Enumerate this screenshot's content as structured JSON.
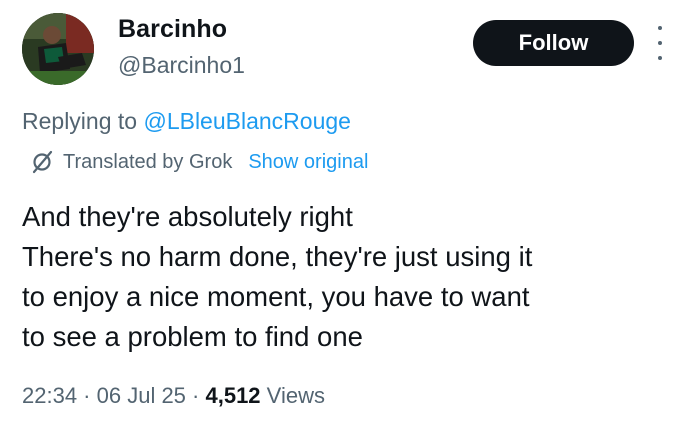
{
  "author": {
    "display_name": "Barcinho",
    "handle": "@Barcinho1"
  },
  "follow_label": "Follow",
  "reply": {
    "prefix": "Replying to",
    "mention": "@LBleuBlancRouge"
  },
  "translation": {
    "icon": "translate-icon",
    "label": "Translated by Grok",
    "show_original": "Show original"
  },
  "tweet": {
    "lines": [
      "And they're absolutely right",
      "There's no harm done, they're just using it",
      "to enjoy a nice moment, you have to want",
      "to see a problem to find one"
    ]
  },
  "meta": {
    "time": "22:34",
    "date": "06 Jul 25",
    "views_count": "4,512",
    "views_label": "Views"
  },
  "colors": {
    "text": "#0f1419",
    "secondary": "#536471",
    "link": "#1d9bf0",
    "follow_bg": "#0f1419"
  }
}
